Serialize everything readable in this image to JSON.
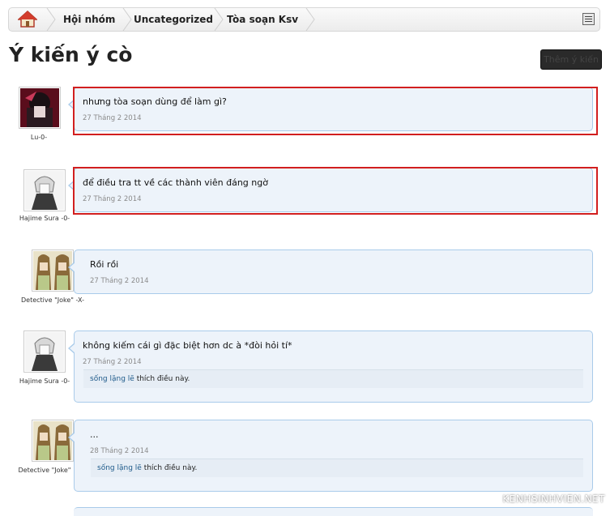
{
  "breadcrumb": {
    "items": [
      "Hội nhóm",
      "Uncategorized",
      "Tòa soạn Ksv"
    ]
  },
  "page": {
    "title": "Ý kiến ý cò",
    "action_button": "Thêm ý kiến"
  },
  "messages": [
    {
      "user": "Lu-0-",
      "text": "nhưng tòa soạn dùng để làm gì?",
      "date": "27 Tháng 2 2014"
    },
    {
      "user": "Hajime Sura -0-",
      "text": "để điều tra tt về các thành viên đáng ngờ",
      "date": "27 Tháng 2 2014"
    },
    {
      "user": "Detective \"Joke\" -X-",
      "text": "Rồi rồi",
      "date": "27 Tháng 2 2014"
    },
    {
      "user": "Hajime Sura -0-",
      "text": "không kiếm cái gì đặc biệt hơn dc à *đòi hỏi tí*",
      "date": "27 Tháng 2 2014",
      "likes": {
        "name": "sống lặng lẽ",
        "suffix": "thích điều này."
      }
    },
    {
      "user": "Detective \"Joke\"",
      "text": "...",
      "date": "28 Tháng 2 2014",
      "likes": {
        "name": "sống lặng lẽ",
        "suffix": "thích điều này."
      }
    }
  ],
  "watermark": "KENHSINHVIEN.NET",
  "colors": {
    "highlight": "#d21f1f",
    "bubble_bg": "#edf3fa",
    "bubble_border": "#a9cbea"
  }
}
